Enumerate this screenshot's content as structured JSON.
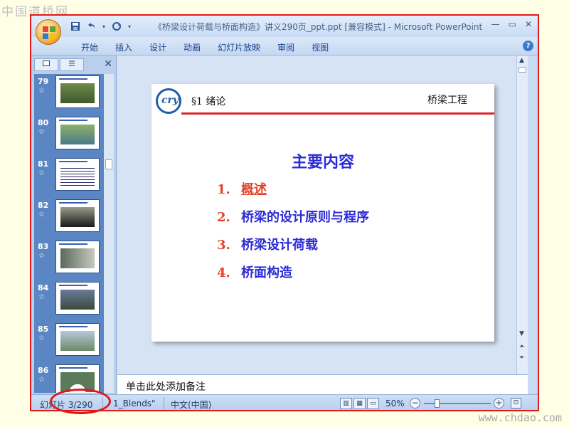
{
  "watermark": {
    "top": "中国道桥网",
    "bottom": "www.chdao.com"
  },
  "window": {
    "title": "《桥梁设计荷载与桥面构造》讲义290页_ppt.ppt [兼容模式] - Microsoft PowerPoint",
    "controls": {
      "minimize": "—",
      "restore": "▭",
      "close": "✕"
    }
  },
  "quick_access": {
    "save_icon": "save-icon",
    "undo_icon": "undo-icon",
    "redo_icon": "redo-icon"
  },
  "ribbon": {
    "tabs": [
      "开始",
      "插入",
      "设计",
      "动画",
      "幻灯片放映",
      "审阅",
      "视图"
    ],
    "help": "?"
  },
  "slide_panel": {
    "close": "✕",
    "thumbnails": [
      {
        "number": "79",
        "star": "☆"
      },
      {
        "number": "80",
        "star": "☆"
      },
      {
        "number": "81",
        "star": "☆"
      },
      {
        "number": "82",
        "star": "☆"
      },
      {
        "number": "83",
        "star": "☆"
      },
      {
        "number": "84",
        "star": "☆"
      },
      {
        "number": "85",
        "star": "☆"
      },
      {
        "number": "86",
        "star": "☆"
      }
    ]
  },
  "slide": {
    "logo_text": "cry",
    "section": "§1  绪论",
    "course": "桥梁工程",
    "title": "主要内容",
    "items": [
      {
        "num": "1.",
        "text": "概述"
      },
      {
        "num": "2.",
        "text": "桥梁的设计原则与程序"
      },
      {
        "num": "3.",
        "text": "桥梁设计荷载"
      },
      {
        "num": "4.",
        "text": "桥面构造"
      }
    ]
  },
  "notes": {
    "placeholder": "单击此处添加备注"
  },
  "status_bar": {
    "slide_info": "幻灯片 3/290",
    "theme": "1_Blends\"",
    "language": "中文(中国)",
    "zoom": "50%",
    "zoom_minus": "−",
    "zoom_plus": "+"
  },
  "colors": {
    "highlight": "#e01818",
    "slide_title": "#2b2bd6",
    "slide_number": "#e0452a"
  }
}
